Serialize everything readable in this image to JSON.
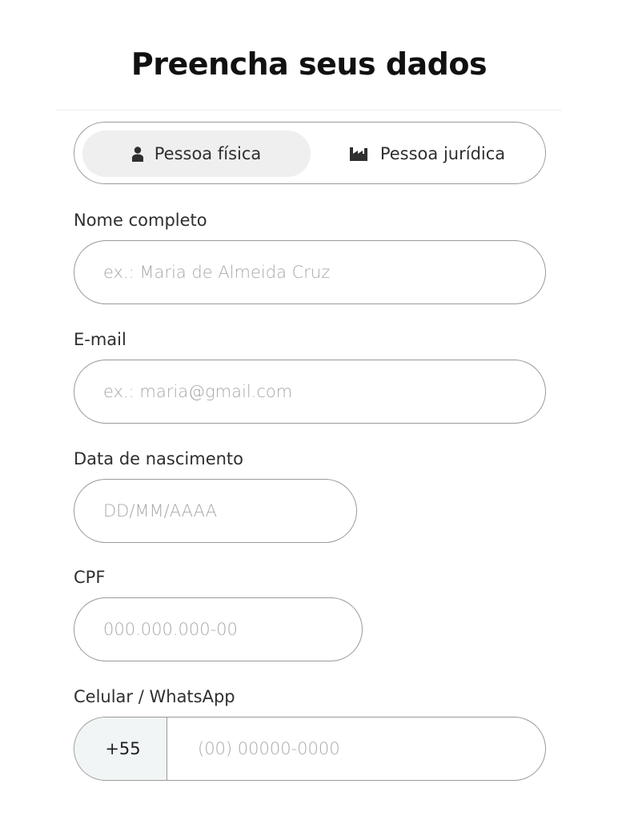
{
  "page": {
    "title": "Preencha seus dados"
  },
  "person_type": {
    "options": [
      {
        "label": "Pessoa física",
        "icon": "person-icon",
        "selected": true
      },
      {
        "label": "Pessoa jurídica",
        "icon": "factory-icon",
        "selected": false
      }
    ]
  },
  "form": {
    "full_name": {
      "label": "Nome completo",
      "placeholder": "ex.: Maria de Almeida Cruz",
      "value": ""
    },
    "email": {
      "label": "E-mail",
      "placeholder": "ex.: maria@gmail.com",
      "value": ""
    },
    "birth_date": {
      "label": "Data de nascimento",
      "placeholder": "DD/MM/AAAA",
      "value": ""
    },
    "cpf": {
      "label": "CPF",
      "placeholder": "000.000.000-00",
      "value": ""
    },
    "phone": {
      "label": "Celular / WhatsApp",
      "country_code": "+55",
      "placeholder": "(00) 00000-0000",
      "value": ""
    }
  },
  "colors": {
    "border": "#9a9a9a",
    "selected_tab_bg": "#efefef",
    "prefix_bg": "#f2f5f6",
    "placeholder": "#a8a8a8"
  }
}
